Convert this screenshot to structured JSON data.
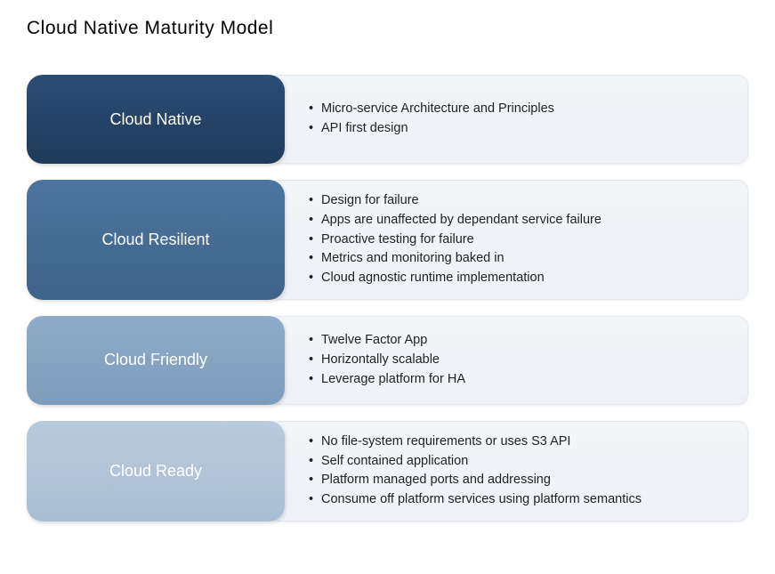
{
  "title": "Cloud  Native Maturity Model",
  "levels": [
    {
      "name": "Cloud Native",
      "colorClass": "color-0",
      "points": [
        "Micro-service Architecture and Principles",
        "API first design"
      ]
    },
    {
      "name": "Cloud Resilient",
      "colorClass": "color-1",
      "points": [
        "Design for failure",
        "Apps are unaffected by dependant service failure",
        "Proactive testing for failure",
        "Metrics and monitoring baked in",
        "Cloud agnostic runtime implementation"
      ]
    },
    {
      "name": "Cloud Friendly",
      "colorClass": "color-2",
      "points": [
        "Twelve Factor App",
        "Horizontally scalable",
        "Leverage platform for HA"
      ]
    },
    {
      "name": "Cloud Ready",
      "colorClass": "color-3",
      "points": [
        "No file-system requirements or uses S3 API",
        "Self contained application",
        "Platform managed ports and addressing",
        "Consume off platform services using platform semantics"
      ]
    }
  ]
}
